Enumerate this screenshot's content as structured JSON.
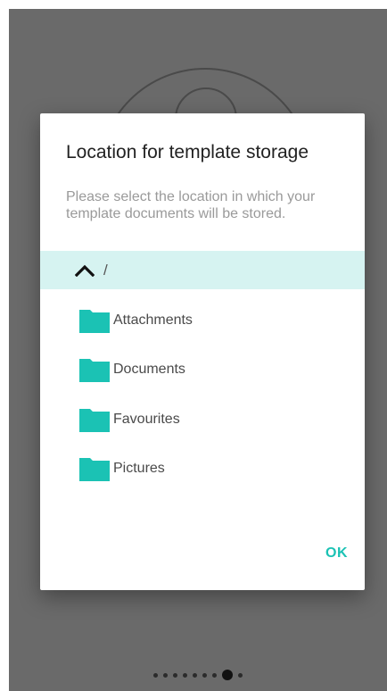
{
  "dialog": {
    "title": "Location for template storage",
    "message": "Please select the location in which your template documents will be stored.",
    "current_path": "/",
    "folders": [
      {
        "name": "Attachments",
        "icon": "folder-icon"
      },
      {
        "name": "Documents",
        "icon": "folder-icon"
      },
      {
        "name": "Favourites",
        "icon": "folder-icon"
      },
      {
        "name": "Pictures",
        "icon": "folder-icon"
      }
    ],
    "ok_label": "OK"
  },
  "pager": {
    "total_pages": 9,
    "current_page": 8
  },
  "colors": {
    "accent": "#1bc2b4",
    "path_highlight": "#d6f3f1",
    "folder": "#1bc2b4",
    "scrim": "#6a6a6a"
  }
}
